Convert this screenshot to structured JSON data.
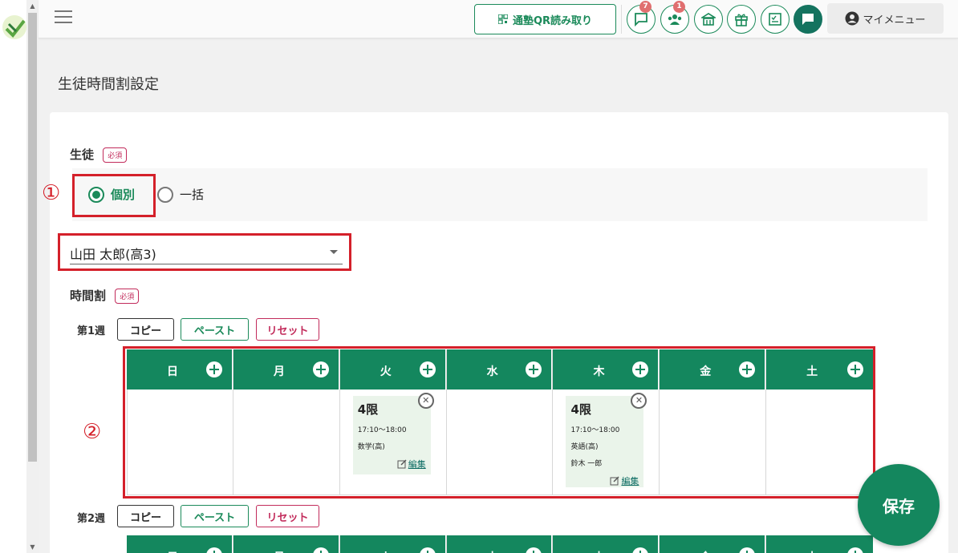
{
  "header": {
    "qr_button": "通塾QR読み取り",
    "badges": {
      "messages": "7",
      "group": "1"
    },
    "my_menu": "マイメニュー"
  },
  "page": {
    "title": "生徒時間割設定"
  },
  "student": {
    "label": "生徒",
    "required": "必須",
    "options": [
      {
        "label": "個別",
        "checked": true
      },
      {
        "label": "一括",
        "checked": false
      }
    ],
    "selected": "山田 太郎(高3)"
  },
  "timetable": {
    "label": "時間割",
    "required": "必須",
    "buttons": {
      "copy": "コピー",
      "paste": "ペースト",
      "reset": "リセット"
    },
    "days": [
      "日",
      "月",
      "火",
      "水",
      "木",
      "金",
      "土"
    ],
    "weeks": [
      {
        "label": "第1週",
        "slots": [
          {
            "day_index": 2,
            "period": "4限",
            "time": "17:10～18:00",
            "subject": "数学(高)",
            "teacher": "",
            "edit": "編集"
          },
          {
            "day_index": 4,
            "period": "4限",
            "time": "17:10～18:00",
            "subject": "英語(高)",
            "teacher": "鈴木 一郎",
            "edit": "編集"
          }
        ]
      },
      {
        "label": "第2週",
        "slots": []
      }
    ]
  },
  "annotations": {
    "one": "①",
    "two": "②"
  },
  "save_button": "保存",
  "colors": {
    "accent": "#14875e",
    "required": "#c22b5b",
    "highlight": "#d4202a"
  }
}
